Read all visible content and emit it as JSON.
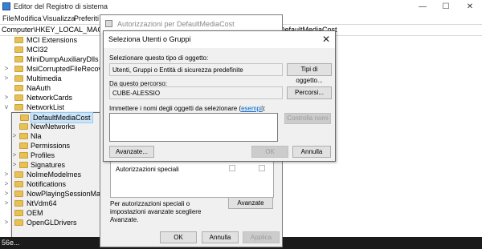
{
  "registry": {
    "title": "Editor del Registro di sistema",
    "menu": [
      "File",
      "Modifica",
      "Visualizza",
      "Preferiti"
    ],
    "address_left": "Computer\\HKEY_LOCAL_MACHINE\\",
    "address_right": "DefaultMediaCost",
    "tree": [
      {
        "label": "MCI Extensions",
        "expander": ""
      },
      {
        "label": "MCI32",
        "expander": ""
      },
      {
        "label": "MiniDumpAuxiliaryDlls",
        "expander": ""
      },
      {
        "label": "MsiCorruptedFileRecovery",
        "expander": ">"
      },
      {
        "label": "Multimedia",
        "expander": ">"
      },
      {
        "label": "NaAuth",
        "expander": ""
      },
      {
        "label": "NetworkCards",
        "expander": ">"
      },
      {
        "label": "NetworkList",
        "expander": "v"
      },
      {
        "label": "DefaultMediaCost",
        "expander": ""
      },
      {
        "label": "NewNetworks",
        "expander": ""
      },
      {
        "label": "Nla",
        "expander": ">"
      },
      {
        "label": "Permissions",
        "expander": ""
      },
      {
        "label": "Profiles",
        "expander": ">"
      },
      {
        "label": "Signatures",
        "expander": ">"
      },
      {
        "label": "NoImeModelmes",
        "expander": ">"
      },
      {
        "label": "Notifications",
        "expander": ">"
      },
      {
        "label": "NowPlayingSessionManager",
        "expander": ">"
      },
      {
        "label": "NtVdm64",
        "expander": ">"
      },
      {
        "label": "OEM",
        "expander": ""
      },
      {
        "label": "OpenGLDrivers",
        "expander": ">"
      }
    ],
    "status_text": "56e..."
  },
  "perm_dialog": {
    "title": "Autorizzazioni per DefaultMediaCost",
    "special_row": "Autorizzazioni speciali",
    "note": "Per autorizzazioni speciali o impostazioni avanzate scegliere Avanzate.",
    "advanced_button": "Avanzate",
    "ok_button": "OK",
    "cancel_button": "Annulla",
    "apply_button": "Applica"
  },
  "select_dialog": {
    "title": "Seleziona Utenti o Gruppi",
    "object_type_label": "Selezionare questo tipo di oggetto:",
    "object_type_value": "Utenti, Gruppi o Entità di sicurezza predefinite",
    "object_types_button": "Tipi di oggetto...",
    "location_label": "Da questo percorso:",
    "location_value": "CUBE-ALESSIO",
    "locations_button": "Percorsi...",
    "names_label": "Immettere i nomi degli oggetti da selezionare (",
    "names_label_link": "esempi",
    "names_label_end": "):",
    "names_value": "",
    "check_names_button": "Controlla nomi",
    "advanced_button": "Avanzate...",
    "ok_button": "OK",
    "cancel_button": "Annulla"
  },
  "window_controls": {
    "minimize": "—",
    "maximize": "☐",
    "close": "✕"
  }
}
